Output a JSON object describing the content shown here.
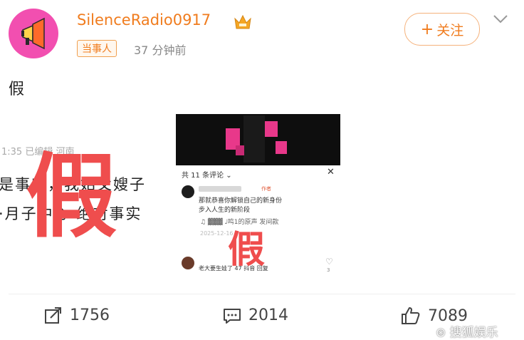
{
  "post": {
    "username": "SilenceRadio0917",
    "badge": "当事人",
    "time": "37 分钟前",
    "follow_label": "关注",
    "text": "假"
  },
  "left_screenshot": {
    "meta": "1:35  已编辑  河南",
    "line1": "是事实，我姑父嫂子",
    "line2": "·月子中心 绝对事实",
    "stamp": "假"
  },
  "right_screenshot": {
    "comments_header": "共 11 条评论 ⌄",
    "close": "✕",
    "comment_tag": "作者",
    "comment_line1": "那就恭喜你解锁自己的新身份",
    "comment_line2": "步入人生的新阶段",
    "music_text": "♫  ▓▓▓   ♩鸣1的原声   发间款",
    "date": "2025-12-16",
    "comment2_text": "老大要生娃了   47 抖音  回复",
    "heart": "♡",
    "heart_count": "3",
    "stamp": "假"
  },
  "actions": {
    "share_count": "1756",
    "comment_count": "2014",
    "like_count": "7089"
  },
  "watermark": "搜狐娱乐",
  "colors": {
    "accent": "#f07c1e",
    "stamp_red": "#ef4d4d",
    "avatar_bg": "#f24fb0"
  }
}
